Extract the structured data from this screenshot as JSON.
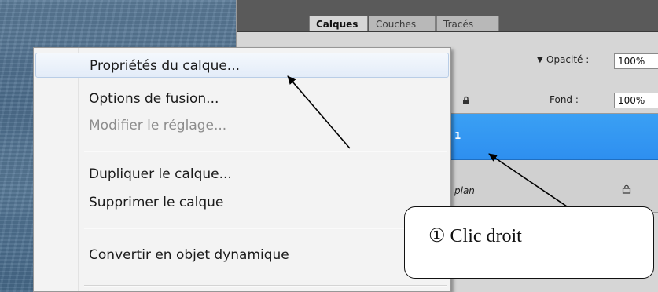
{
  "panel": {
    "tabs": [
      {
        "label": "Calques",
        "active": true
      },
      {
        "label": "Couches",
        "active": false
      },
      {
        "label": "Tracés",
        "active": false
      }
    ],
    "opacity_label": "Opacité :",
    "opacity_value": "100%",
    "fill_label": "Fond :",
    "fill_value": "100%",
    "layers": [
      {
        "name": "1",
        "selected": true
      },
      {
        "name": "plan",
        "selected": false,
        "locked": true
      }
    ]
  },
  "context_menu": {
    "items": [
      {
        "label": "Propriétés du calque...",
        "state": "hover"
      },
      {
        "label": "Options de fusion...",
        "state": "normal"
      },
      {
        "label": "Modifier le réglage...",
        "state": "disabled"
      },
      {
        "label": "Dupliquer le calque...",
        "state": "normal"
      },
      {
        "label": "Supprimer le calque",
        "state": "normal"
      },
      {
        "label": "Convertir en objet dynamique",
        "state": "normal"
      }
    ]
  },
  "annotation": {
    "text": "① Clic droit"
  },
  "colors": {
    "selected_layer": "#2e8ff0",
    "menu_background": "#f3f3f3",
    "menu_hover_border": "#b9cde6",
    "tabbar": "#5a5a5a"
  }
}
